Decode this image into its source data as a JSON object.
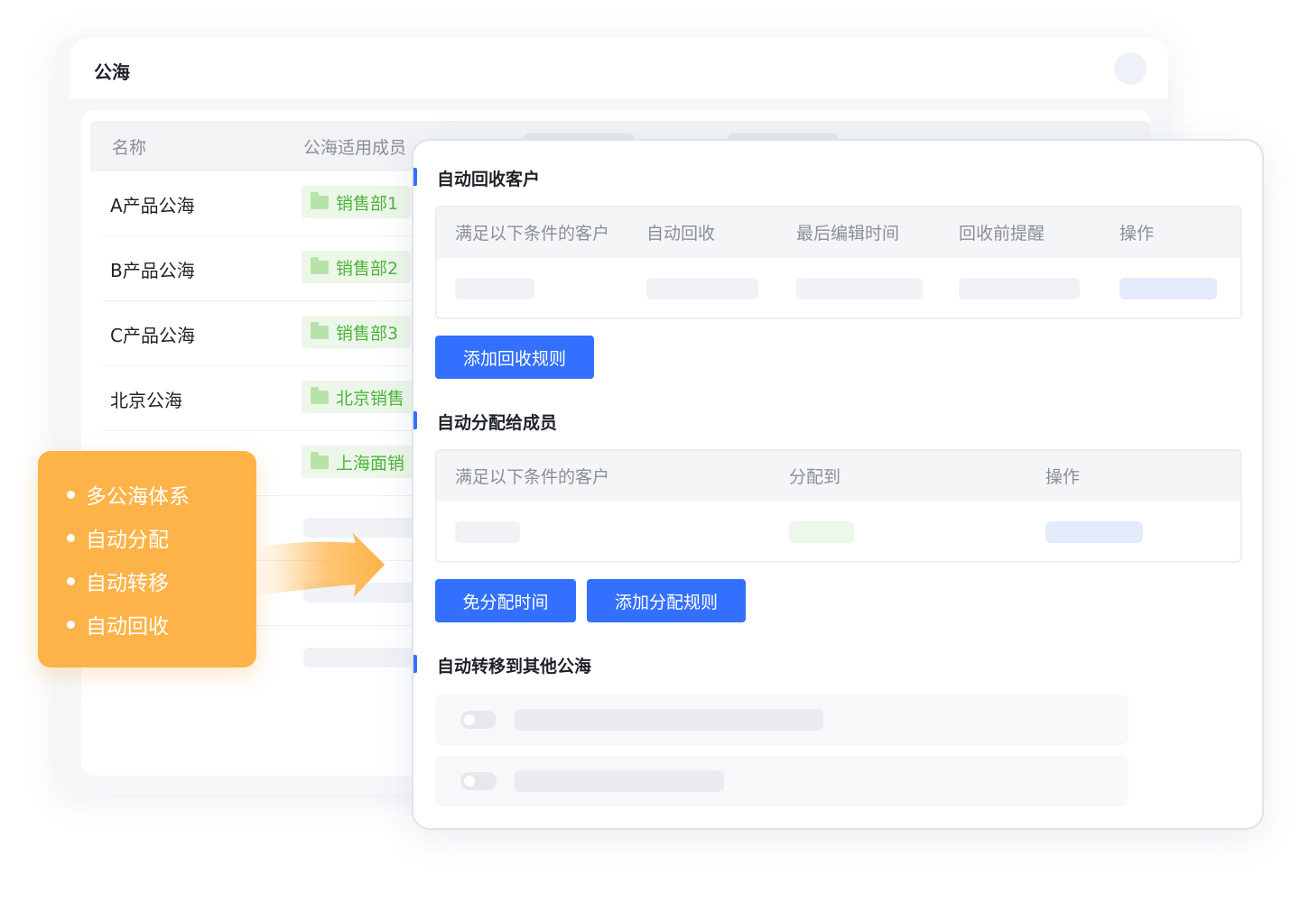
{
  "back_window": {
    "title": "公海",
    "columns": [
      "名称",
      "公海适用成员"
    ],
    "rows": [
      {
        "name": "A产品公海",
        "dept": "销售部1"
      },
      {
        "name": "B产品公海",
        "dept": "销售部2"
      },
      {
        "name": "C产品公海",
        "dept": "销售部3"
      },
      {
        "name": "北京公海",
        "dept": "北京销售"
      },
      {
        "name": "",
        "dept": "上海面销"
      }
    ]
  },
  "features": {
    "items": [
      "多公海体系",
      "自动分配",
      "自动转移",
      "自动回收"
    ]
  },
  "dialog": {
    "recycle": {
      "title": "自动回收客户",
      "columns": [
        "满足以下条件的客户",
        "自动回收",
        "最后编辑时间",
        "回收前提醒",
        "操作"
      ],
      "add_button": "添加回收规则"
    },
    "assign": {
      "title": "自动分配给成员",
      "columns": [
        "满足以下条件的客户",
        "分配到",
        "操作"
      ],
      "free_time_button": "免分配时间",
      "add_button": "添加分配规则"
    },
    "transfer": {
      "title": "自动转移到其他公海"
    }
  },
  "colors": {
    "primary": "#3370ff",
    "orange": "#fdb347",
    "tag_green_text": "#4fb43a",
    "tag_green_bg": "#ecf7e9"
  }
}
